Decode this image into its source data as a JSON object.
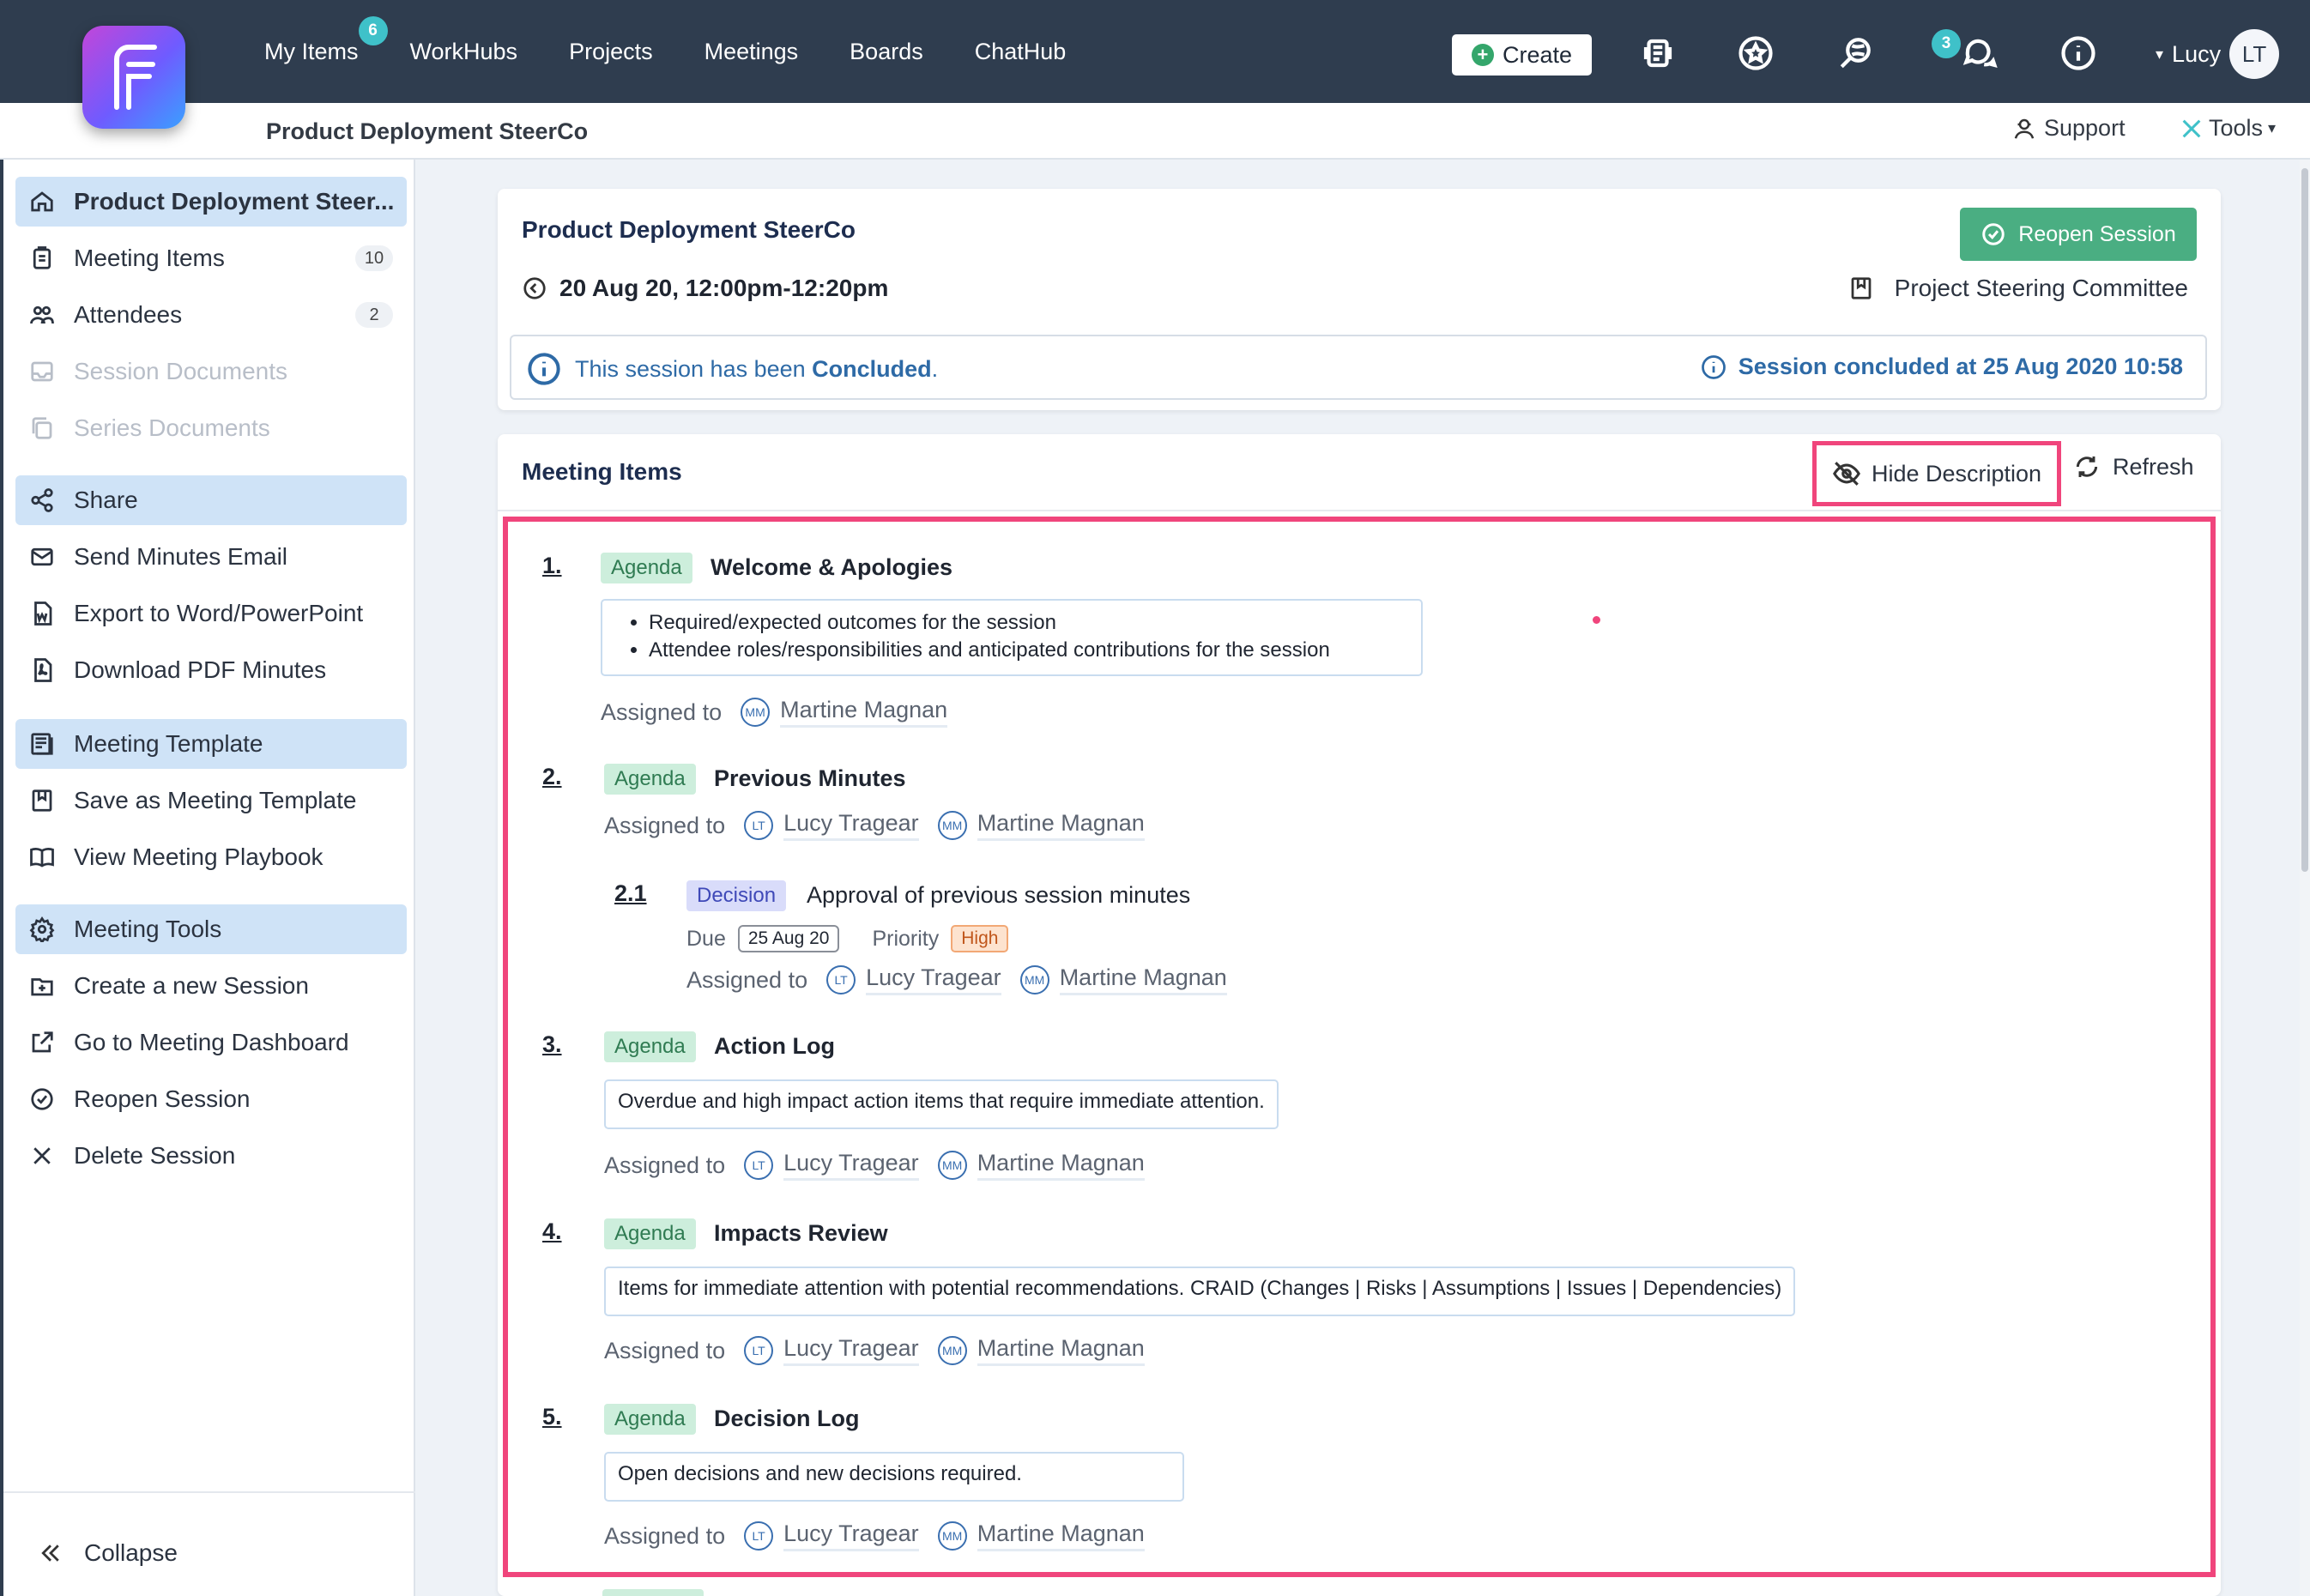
{
  "topbar": {
    "nav": [
      {
        "label": "My Items",
        "badge": "6"
      },
      {
        "label": "WorkHubs"
      },
      {
        "label": "Projects"
      },
      {
        "label": "Meetings"
      },
      {
        "label": "Boards"
      },
      {
        "label": "ChatHub"
      }
    ],
    "create_label": "Create",
    "chat_badge": "3",
    "user_name": "Lucy",
    "user_initials": "LT",
    "icons": [
      "action-items-icon",
      "star-icon",
      "search-globe-icon",
      "chat-icon",
      "info-icon"
    ]
  },
  "subbar": {
    "title": "Product Deployment SteerCo",
    "support_label": "Support",
    "tools_label": "Tools"
  },
  "sidebar": {
    "items": [
      {
        "label": "Product Deployment Steer...",
        "icon": "home-icon",
        "active": true
      },
      {
        "label": "Meeting Items",
        "icon": "clipboard-icon",
        "count": "10"
      },
      {
        "label": "Attendees",
        "icon": "users-icon",
        "count": "2"
      },
      {
        "label": "Session Documents",
        "icon": "inbox-icon",
        "disabled": true
      },
      {
        "label": "Series Documents",
        "icon": "copy-icon",
        "disabled": true
      },
      {
        "label": "Share",
        "icon": "share-icon",
        "active": true
      },
      {
        "label": "Send Minutes Email",
        "icon": "mail-icon"
      },
      {
        "label": "Export to Word/PowerPoint",
        "icon": "word-icon"
      },
      {
        "label": "Download PDF Minutes",
        "icon": "pdf-icon"
      },
      {
        "label": "Meeting Template",
        "icon": "template-icon",
        "active": true
      },
      {
        "label": "Save as Meeting Template",
        "icon": "bookmark-icon"
      },
      {
        "label": "View Meeting Playbook",
        "icon": "book-icon"
      },
      {
        "label": "Meeting Tools",
        "icon": "gear-icon",
        "active": true
      },
      {
        "label": "Create a new Session",
        "icon": "folder-plus-icon"
      },
      {
        "label": "Go to Meeting Dashboard",
        "icon": "external-link-icon"
      },
      {
        "label": "Reopen Session",
        "icon": "check-circle-icon"
      },
      {
        "label": "Delete Session",
        "icon": "close-icon"
      }
    ],
    "collapse_label": "Collapse"
  },
  "session": {
    "title": "Product Deployment SteerCo",
    "reopen_label": "Reopen Session",
    "datetime": "20 Aug 20, 12:00pm-12:20pm",
    "committee": "Project Steering Committee",
    "status_prefix": "This session has been ",
    "status_word": "Concluded",
    "status_suffix": ".",
    "concluded_at": "Session concluded at 25 Aug 2020 10:58"
  },
  "meeting_items": {
    "title": "Meeting Items",
    "hide_description_label": "Hide Description",
    "refresh_label": "Refresh",
    "assigned_label": "Assigned to",
    "items": [
      {
        "num": "1.",
        "tag": "Agenda",
        "title": "Welcome & Apologies",
        "bullets": [
          "Required/expected outcomes for the session",
          "Attendee roles/responsibilities and anticipated contributions for the session"
        ],
        "assignees": [
          {
            "initials": "MM",
            "name": "Martine Magnan"
          }
        ]
      },
      {
        "num": "2.",
        "tag": "Agenda",
        "title": "Previous Minutes",
        "assignees": [
          {
            "initials": "LT",
            "name": "Lucy Tragear"
          },
          {
            "initials": "MM",
            "name": "Martine Magnan"
          }
        ],
        "subitem": {
          "num": "2.1",
          "tag": "Decision",
          "title": "Approval of previous session minutes",
          "due_label": "Due",
          "due": "25 Aug 20",
          "priority_label": "Priority",
          "priority": "High",
          "assignees": [
            {
              "initials": "LT",
              "name": "Lucy Tragear"
            },
            {
              "initials": "MM",
              "name": "Martine Magnan"
            }
          ]
        }
      },
      {
        "num": "3.",
        "tag": "Agenda",
        "title": "Action Log",
        "description": "Overdue and high impact action items that require immediate attention.",
        "assignees": [
          {
            "initials": "LT",
            "name": "Lucy Tragear"
          },
          {
            "initials": "MM",
            "name": "Martine Magnan"
          }
        ]
      },
      {
        "num": "4.",
        "tag": "Agenda",
        "title": "Impacts Review",
        "description": "Items for immediate attention with potential recommendations. CRAID (Changes | Risks | Assumptions | Issues | Dependencies)",
        "assignees": [
          {
            "initials": "LT",
            "name": "Lucy Tragear"
          },
          {
            "initials": "MM",
            "name": "Martine Magnan"
          }
        ]
      },
      {
        "num": "5.",
        "tag": "Agenda",
        "title": "Decision Log",
        "description": "Open decisions and new decisions required.",
        "assignees": [
          {
            "initials": "LT",
            "name": "Lucy Tragear"
          },
          {
            "initials": "MM",
            "name": "Martine Magnan"
          }
        ]
      }
    ]
  },
  "colors": {
    "topbar": "#2f3d4f",
    "accent_green": "#4aae82",
    "highlight": "#f0457c",
    "active_nav": "#cfe3f7",
    "link_blue": "#2e6aa6"
  }
}
